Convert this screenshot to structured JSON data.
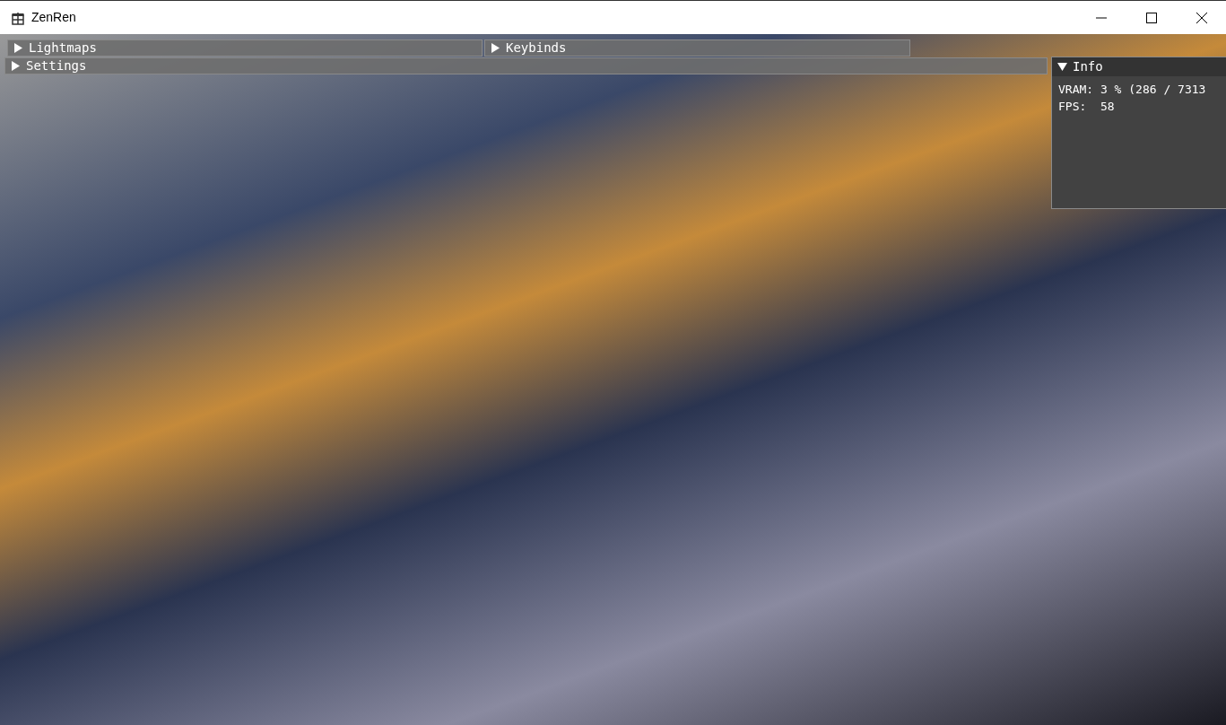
{
  "window": {
    "title": "ZenRen"
  },
  "panels": [
    {
      "title": "Lightmaps",
      "expanded": false
    },
    {
      "title": "Keybinds",
      "expanded": false
    },
    {
      "title": "Settings",
      "expanded": false
    }
  ],
  "info": {
    "title": "Info",
    "expanded": true,
    "lines": [
      "VRAM: 3 % (286 / 7313",
      "FPS:  58"
    ]
  }
}
